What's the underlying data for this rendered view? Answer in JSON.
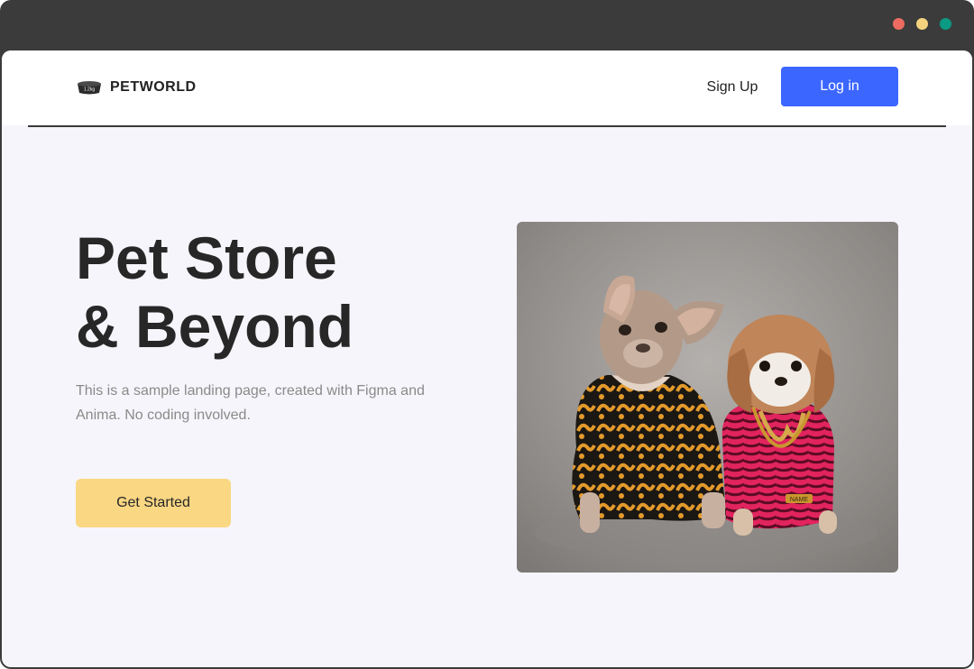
{
  "window": {
    "controls": [
      {
        "name": "close",
        "color": "#ed6b60"
      },
      {
        "name": "minimize",
        "color": "#f5d37e"
      },
      {
        "name": "maximize",
        "color": "#0b9a83"
      }
    ],
    "frame_color": "#3b3b3b"
  },
  "nav": {
    "brand": "PETWORLD",
    "logo_icon": "pet-bowl-icon",
    "logo_badge": "1.2kg",
    "signup_label": "Sign Up",
    "login_label": "Log in"
  },
  "hero": {
    "title_line1": "Pet Store",
    "title_line2": "& Beyond",
    "description": "This is a sample landing page, created with Figma and Anima. No coding involved.",
    "cta_label": "Get Started",
    "image_name": "two-dogs-in-jackets-photo",
    "dog_tag": "NAME"
  },
  "colors": {
    "accent_blue": "#3b66ff",
    "cta_yellow": "#f9d783",
    "page_bg": "#f6f5fb",
    "heading": "#272727",
    "muted_text": "#8a8a8a"
  }
}
